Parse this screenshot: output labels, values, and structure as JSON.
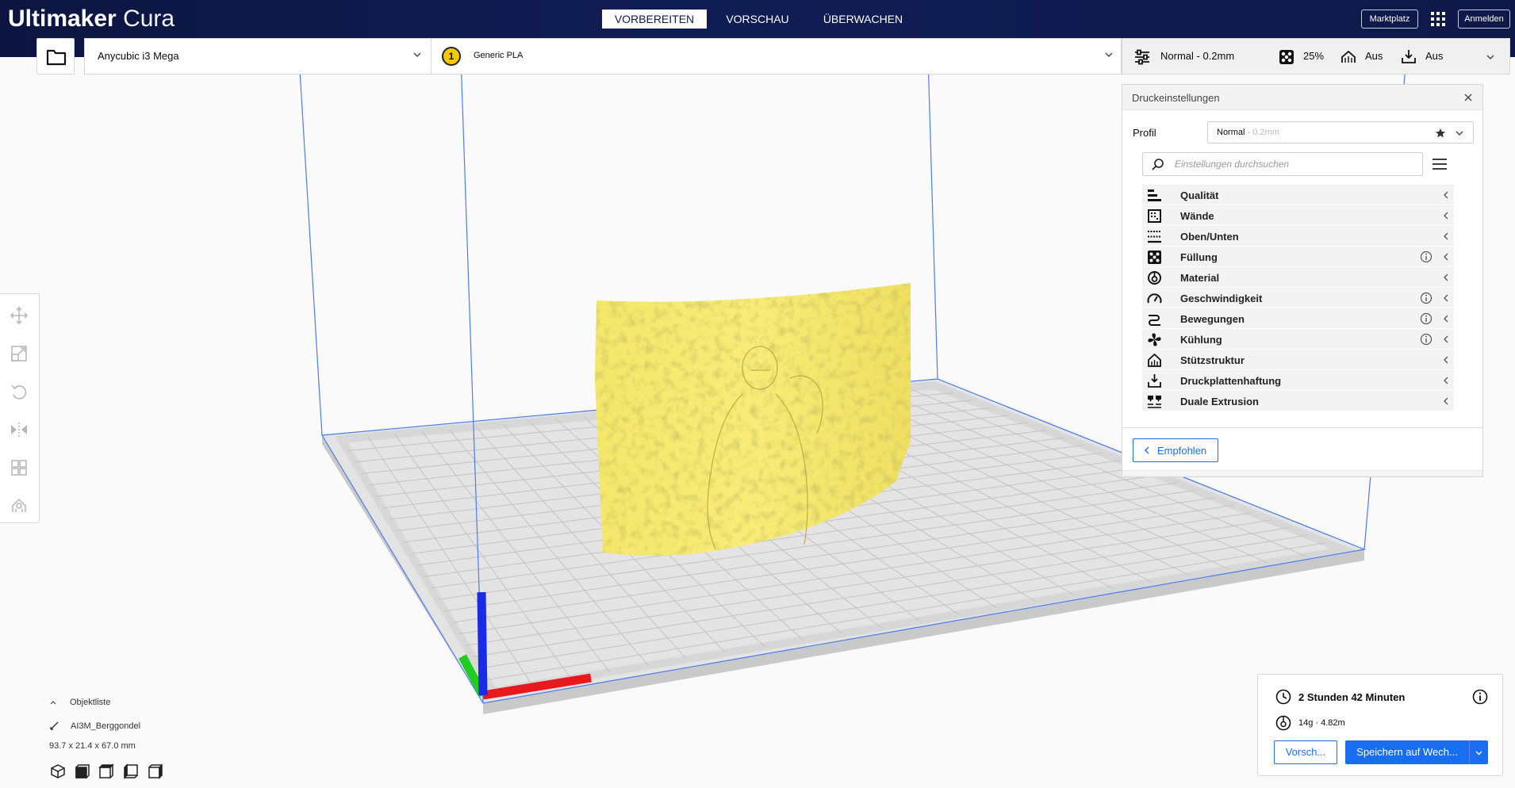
{
  "app": {
    "name_bold": "Ultimaker",
    "name_light": "Cura"
  },
  "nav": [
    {
      "label": "VORBEREITEN",
      "active": true
    },
    {
      "label": "VORSCHAU",
      "active": false
    },
    {
      "label": "ÜBERWACHEN",
      "active": false
    }
  ],
  "header_buttons": {
    "marketplace": "Marktplatz",
    "signin": "Anmelden"
  },
  "machine": {
    "printer": "Anycubic i3 Mega",
    "extruder_number": "1",
    "extruder_color": "#f3c900",
    "material": "Generic PLA"
  },
  "print_settings_bar": {
    "profile": "Normal - 0.2mm",
    "infill": "25%",
    "support": "Aus",
    "adhesion": "Aus"
  },
  "panel": {
    "title": "Druckeinstellungen",
    "profile_label": "Profil",
    "profile_name": "Normal",
    "profile_sub": "- 0.2mm",
    "search_placeholder": "Einstellungen durchsuchen",
    "categories": [
      {
        "label": "Qualität",
        "icon": "quality-icon",
        "info": false
      },
      {
        "label": "Wände",
        "icon": "walls-icon",
        "info": false
      },
      {
        "label": "Oben/Unten",
        "icon": "top-bottom-icon",
        "info": false
      },
      {
        "label": "Füllung",
        "icon": "infill-icon",
        "info": true
      },
      {
        "label": "Material",
        "icon": "material-icon",
        "info": false
      },
      {
        "label": "Geschwindigkeit",
        "icon": "speed-icon",
        "info": true
      },
      {
        "label": "Bewegungen",
        "icon": "travel-icon",
        "info": true
      },
      {
        "label": "Kühlung",
        "icon": "cooling-fan-icon",
        "info": true
      },
      {
        "label": "Stützstruktur",
        "icon": "support-icon",
        "info": false
      },
      {
        "label": "Druckplattenhaftung",
        "icon": "adhesion-icon",
        "info": false
      },
      {
        "label": "Duale Extrusion",
        "icon": "dual-extrusion-icon",
        "info": false
      }
    ],
    "recommended_label": "Empfohlen"
  },
  "objects": {
    "toggle_label": "Objektliste",
    "name": "AI3M_Berggondel",
    "dimensions": "93.7 x 21.4 x 67.0 mm"
  },
  "job": {
    "time": "2 Stunden 42 Minuten",
    "material_usage": "14g · 4.82m",
    "preview_label": "Vorsch...",
    "save_label": "Speichern auf Wech..."
  },
  "colors": {
    "header": "#0e1949",
    "accent": "#196ef0",
    "model": "#f7ea6e"
  }
}
